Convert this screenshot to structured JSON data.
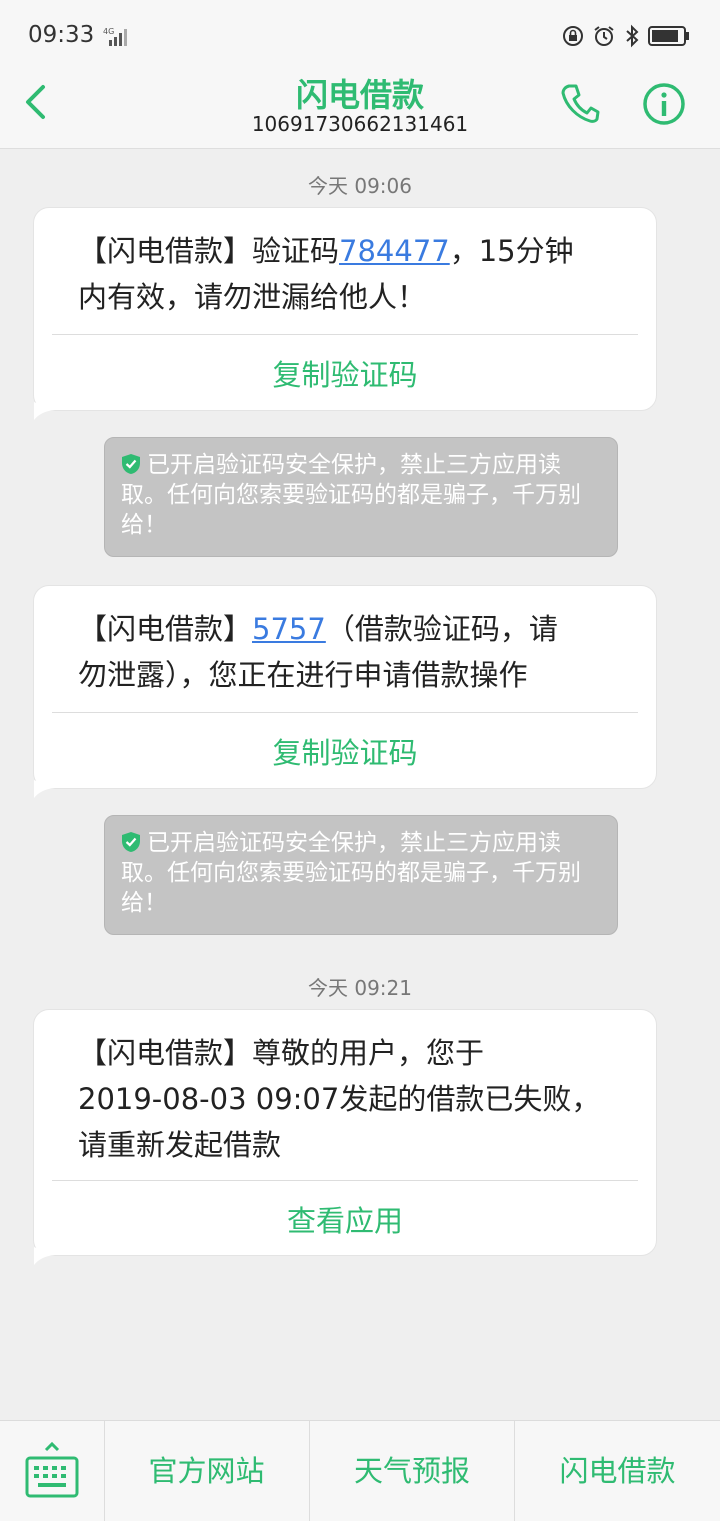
{
  "status": {
    "time": "09:33",
    "network": "4G"
  },
  "header": {
    "title": "闪电借款",
    "number": "10691730662131461"
  },
  "colors": {
    "accent": "#2fbb72",
    "link": "#3a7be0",
    "warn_bg": "#c4c4c4"
  },
  "icons": {
    "back": "chevron-left-icon",
    "call": "phone-icon",
    "info": "info-icon",
    "shield": "shield-check-icon",
    "keyboard": "keyboard-icon"
  },
  "messages": {
    "ts1": "今天 09:06",
    "m1": {
      "prefix": "【闪电借款】验证码",
      "code": "784477",
      "suffix_line1": "，15分钟",
      "line2": "内有效，请勿泄漏给他人！",
      "action": "复制验证码"
    },
    "w1": {
      "text": "已开启验证码安全保护，禁止三方应用读取。任何向您索要验证码的都是骗子，千万别给！"
    },
    "m2": {
      "prefix": "【闪电借款】",
      "code": "5757",
      "suffix_line1": "（借款验证码，请",
      "line2": "勿泄露），您正在进行申请借款操作",
      "action": "复制验证码"
    },
    "w2": {
      "text": "已开启验证码安全保护，禁止三方应用读取。任何向您索要验证码的都是骗子，千万别给！"
    },
    "ts2": "今天 09:21",
    "m3": {
      "line1": "【闪电借款】尊敬的用户，您于",
      "line2": "2019-08-03 09:07发起的借款已失败，",
      "line3": "请重新发起借款",
      "action": "查看应用"
    }
  },
  "bottom": {
    "btn1": "官方网站",
    "btn2": "天气预报",
    "btn3": "闪电借款"
  }
}
